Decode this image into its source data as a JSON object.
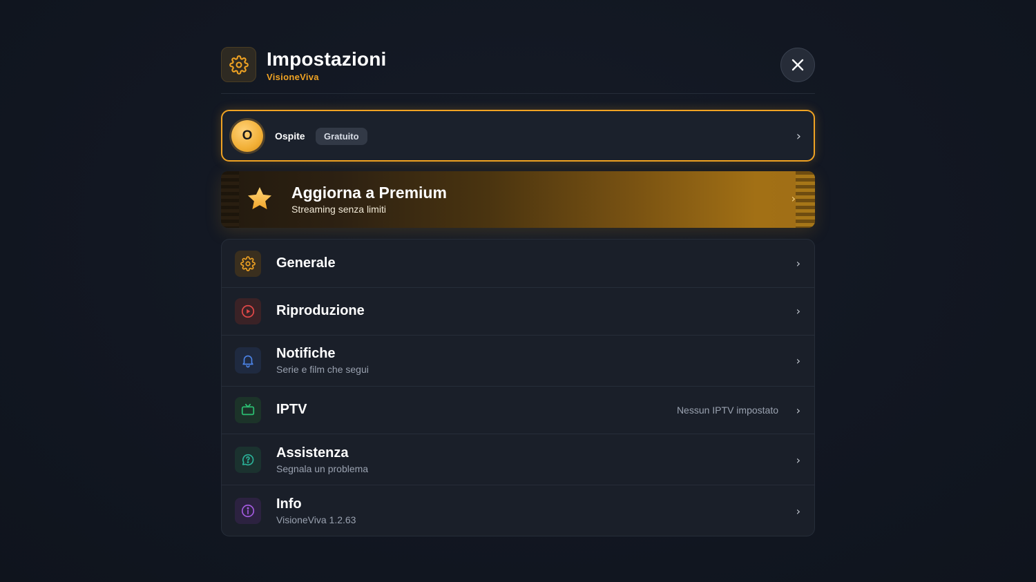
{
  "header": {
    "title": "Impostazioni",
    "subtitle": "VisioneViva",
    "icon": "gear-icon",
    "close_icon": "close-icon"
  },
  "profile": {
    "avatar_initial": "O",
    "name": "Ospite",
    "plan_badge": "Gratuito",
    "chevron": "›"
  },
  "premium": {
    "icon": "star-icon",
    "title": "Aggiorna a Premium",
    "subtitle": "Streaming senza limiti",
    "chevron": "›"
  },
  "menu": {
    "items": [
      {
        "id": "generale",
        "icon": "gear-icon",
        "title": "Generale",
        "subtitle": "",
        "value": "",
        "chevron": "›",
        "color": "#f0a323"
      },
      {
        "id": "riproduzione",
        "icon": "play-circle-icon",
        "title": "Riproduzione",
        "subtitle": "",
        "value": "",
        "chevron": "›",
        "color": "#e04848"
      },
      {
        "id": "notifiche",
        "icon": "bell-icon",
        "title": "Notifiche",
        "subtitle": "Serie e film che segui",
        "value": "",
        "chevron": "›",
        "color": "#4c84e8"
      },
      {
        "id": "iptv",
        "icon": "tv-icon",
        "title": "IPTV",
        "subtitle": "",
        "value": "Nessun IPTV impostato",
        "chevron": "›",
        "color": "#2bbf72"
      },
      {
        "id": "assistenza",
        "icon": "help-chat-icon",
        "title": "Assistenza",
        "subtitle": "Segnala un problema",
        "value": "",
        "chevron": "›",
        "color": "#2bb39a"
      },
      {
        "id": "info",
        "icon": "info-icon",
        "title": "Info",
        "subtitle": "VisioneViva 1.2.63",
        "value": "",
        "chevron": "›",
        "color": "#a45be0"
      }
    ]
  },
  "colors": {
    "accent": "#f0a323",
    "background": "#121722",
    "card": "#1a1f29"
  }
}
